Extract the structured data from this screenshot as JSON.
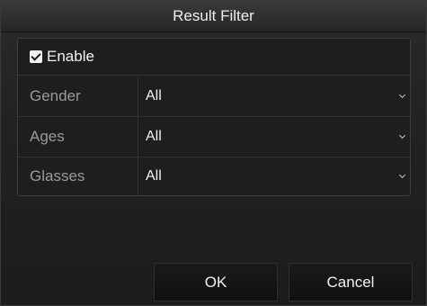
{
  "dialog": {
    "title": "Result Filter"
  },
  "filter": {
    "enable_label": "Enable",
    "enable_checked": true,
    "fields": [
      {
        "label": "Gender",
        "value": "All"
      },
      {
        "label": "Ages",
        "value": "All"
      },
      {
        "label": "Glasses",
        "value": "All"
      }
    ]
  },
  "buttons": {
    "ok": "OK",
    "cancel": "Cancel"
  }
}
